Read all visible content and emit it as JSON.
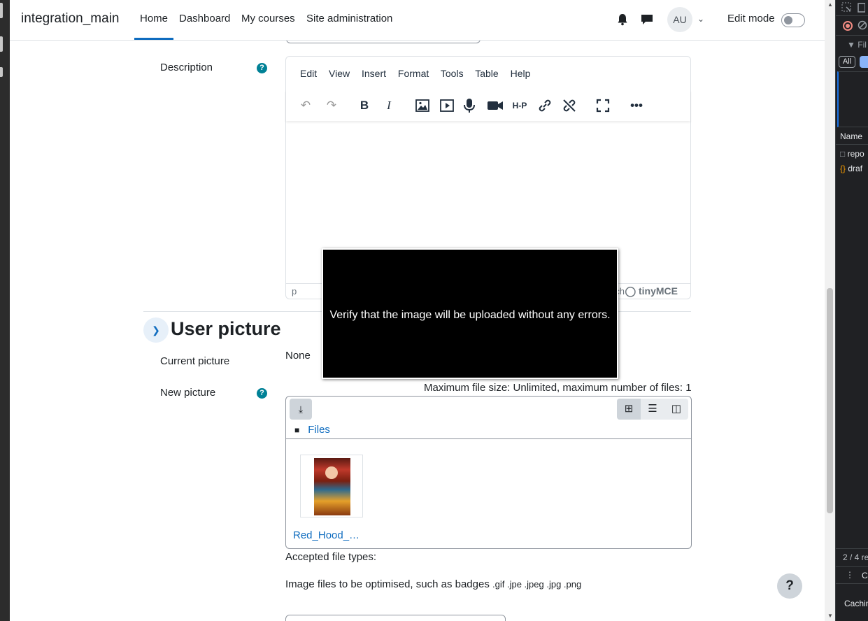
{
  "navbar": {
    "brand": "integration_main",
    "links": [
      "Home",
      "Dashboard",
      "My courses",
      "Site administration"
    ],
    "avatar_initials": "AU",
    "edit_mode_label": "Edit mode"
  },
  "description": {
    "label": "Description",
    "help": "?",
    "menu": [
      "Edit",
      "View",
      "Insert",
      "Format",
      "Tools",
      "Table",
      "Help"
    ],
    "status_path": "p",
    "status_partial": "ch",
    "branding": "tinyMCE"
  },
  "user_picture": {
    "section_title": "User picture",
    "current_picture_label": "Current picture",
    "current_picture_value": "None",
    "new_picture_label": "New picture",
    "help": "?",
    "limits": "Maximum file size: Unlimited, maximum number of files: 1",
    "path_label": "Files",
    "file_name": "Red_Hood_…",
    "accepted_label": "Accepted file types:",
    "types_desc": "Image files to be optimised, such as badges",
    "types_ext": ".gif .jpe .jpeg .jpg .png"
  },
  "tooltip": {
    "text": "Verify that the image will be uploaded without any errors."
  },
  "help_fab": "?",
  "devtools": {
    "filter_partial": "Fil",
    "all_label": "All",
    "name_header": "Name",
    "rows": [
      "repo",
      "draf"
    ],
    "count_partial": "2 / 4 re",
    "drawer_partial": "C",
    "caching_partial": "Cachin"
  },
  "colors": {
    "accent": "#0f6cbf",
    "help_icon": "#008196",
    "tooltip_bg": "#000000"
  }
}
